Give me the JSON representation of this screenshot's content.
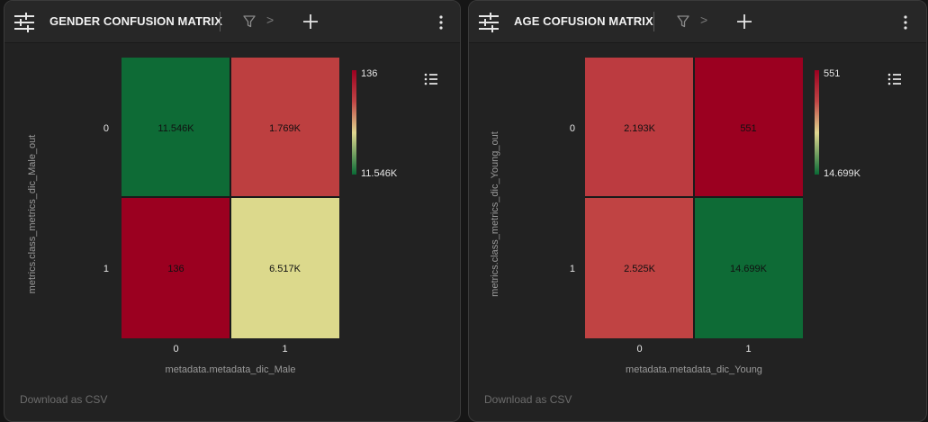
{
  "panels": [
    {
      "title": "GENDER CONFUSION MATRIX",
      "breadcrumb_chevron": ">",
      "footer": "Download as CSV"
    },
    {
      "title": "AGE COFUSION MATRIX",
      "breadcrumb_chevron": ">",
      "footer": "Download as CSV"
    }
  ],
  "colors": {
    "page_bg": "#161616",
    "panel_bg": "#222222",
    "header_bg": "#272727",
    "text": "#e6e6e6",
    "muted": "#6c6c6c",
    "scale_high": "#9b0020",
    "scale_mid1": "#bf4040",
    "scale_mid2": "#dcd98c",
    "scale_low": "#0a6a35"
  },
  "chart_data": [
    {
      "type": "heatmap",
      "x_categories": [
        "0",
        "1"
      ],
      "y_categories": [
        "0",
        "1"
      ],
      "xlabel": "metadata.metadata_dic_Male",
      "ylabel": "metrics.class_metrics_dic_Male_out",
      "cells": [
        {
          "x": "0",
          "y": "0",
          "value": 11546,
          "label": "11.546K",
          "color": "#0e6b36"
        },
        {
          "x": "1",
          "y": "0",
          "value": 1769,
          "label": "1.769K",
          "color": "#bd3f40"
        },
        {
          "x": "0",
          "y": "1",
          "value": 136,
          "label": "136",
          "color": "#9b0020"
        },
        {
          "x": "1",
          "y": "1",
          "value": 6517,
          "label": "6.517K",
          "color": "#dcd98c"
        }
      ],
      "colorbar": {
        "max_label": "136",
        "min_label": "11.546K"
      },
      "grid": false
    },
    {
      "type": "heatmap",
      "x_categories": [
        "0",
        "1"
      ],
      "y_categories": [
        "0",
        "1"
      ],
      "xlabel": "metadata.metadata_dic_Young",
      "ylabel": "metrics.class_metrics_dic_Young_out",
      "cells": [
        {
          "x": "0",
          "y": "0",
          "value": 2193,
          "label": "2.193K",
          "color": "#bc3b40"
        },
        {
          "x": "1",
          "y": "0",
          "value": 551,
          "label": "551",
          "color": "#9b0020"
        },
        {
          "x": "0",
          "y": "1",
          "value": 2525,
          "label": "2.525K",
          "color": "#c04343"
        },
        {
          "x": "1",
          "y": "1",
          "value": 14699,
          "label": "14.699K",
          "color": "#0e6b36"
        }
      ],
      "colorbar": {
        "max_label": "551",
        "min_label": "14.699K"
      },
      "grid": false
    }
  ]
}
